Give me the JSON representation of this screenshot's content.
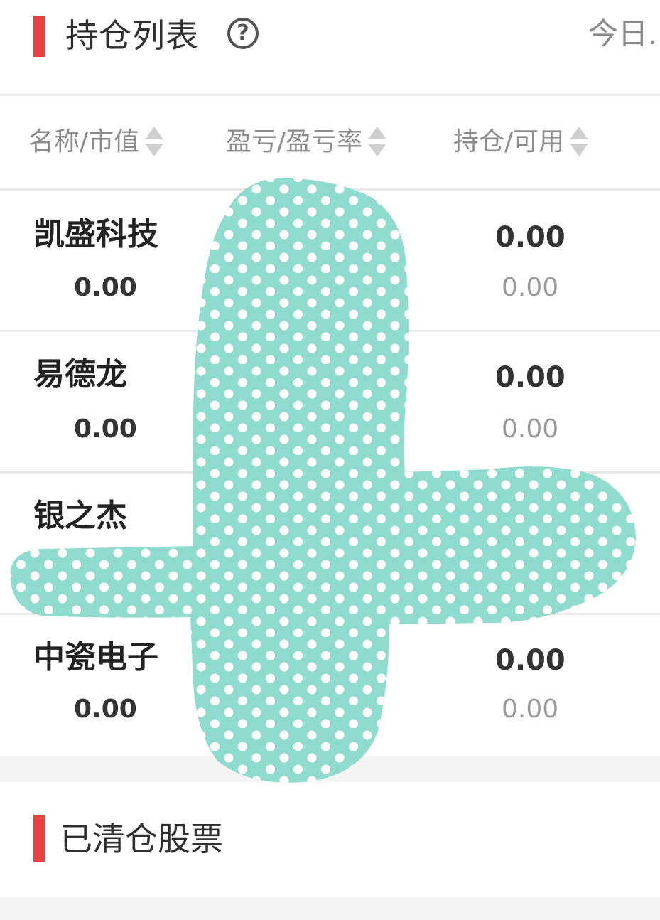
{
  "header": {
    "title": "持仓列表",
    "help_icon": "?",
    "right_link": "今日..."
  },
  "columns": [
    {
      "label": "名称/市值"
    },
    {
      "label": "盈亏/盈亏率"
    },
    {
      "label": "持仓/可用"
    }
  ],
  "holdings": [
    {
      "name": "凯盛科技",
      "market_value": "0.00",
      "position": "0.00",
      "available": "0.00"
    },
    {
      "name": "易德龙",
      "market_value": "0.00",
      "position": "0.00",
      "available": "0.00"
    },
    {
      "name": "银之杰",
      "market_value": "",
      "position": "",
      "available": ""
    },
    {
      "name": "中瓷电子",
      "market_value": "0.00",
      "position": "0.00",
      "available": "0.00"
    }
  ],
  "cleared_section": {
    "title": "已清仓股票"
  },
  "colors": {
    "accent": "#e8413f",
    "overlay": "#8fdbcd"
  }
}
